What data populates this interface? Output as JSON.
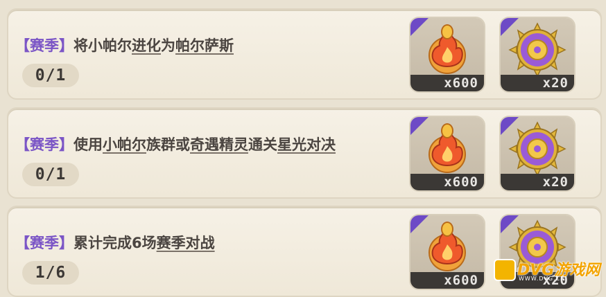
{
  "colors": {
    "tag": "#7b55c6",
    "text": "#4b4541",
    "qty_bg": "#3b3835",
    "corner": "#6d4ac6"
  },
  "quests": [
    {
      "tag": "【赛季】",
      "segments": [
        {
          "text": "将小帕尔",
          "underline": false
        },
        {
          "text": "进化",
          "underline": true
        },
        {
          "text": "为",
          "underline": false
        },
        {
          "text": "帕尔萨斯",
          "underline": true
        }
      ],
      "progress": "0/1",
      "rewards": [
        {
          "icon": "flame-badge-icon",
          "qty": "x600"
        },
        {
          "icon": "spiked-purple-orb-icon",
          "qty": "x20"
        }
      ]
    },
    {
      "tag": "【赛季】",
      "segments": [
        {
          "text": "使用",
          "underline": false
        },
        {
          "text": "小帕尔",
          "underline": true
        },
        {
          "text": "族群或",
          "underline": false
        },
        {
          "text": "奇遇精灵",
          "underline": true
        },
        {
          "text": "通关",
          "underline": false
        },
        {
          "text": "星光对决",
          "underline": true
        }
      ],
      "progress": "0/1",
      "rewards": [
        {
          "icon": "flame-badge-icon",
          "qty": "x600"
        },
        {
          "icon": "spiked-purple-orb-icon",
          "qty": "x20"
        }
      ]
    },
    {
      "tag": "【赛季】",
      "segments": [
        {
          "text": "累计完成6场",
          "underline": false
        },
        {
          "text": "赛季对战",
          "underline": true
        }
      ],
      "progress": "1/6",
      "rewards": [
        {
          "icon": "flame-badge-icon",
          "qty": "x600"
        },
        {
          "icon": "spiked-purple-orb-icon",
          "qty": "x20"
        }
      ]
    }
  ],
  "watermark": {
    "text": "DVG游戏网",
    "url": "WWW.DVG.CN"
  }
}
